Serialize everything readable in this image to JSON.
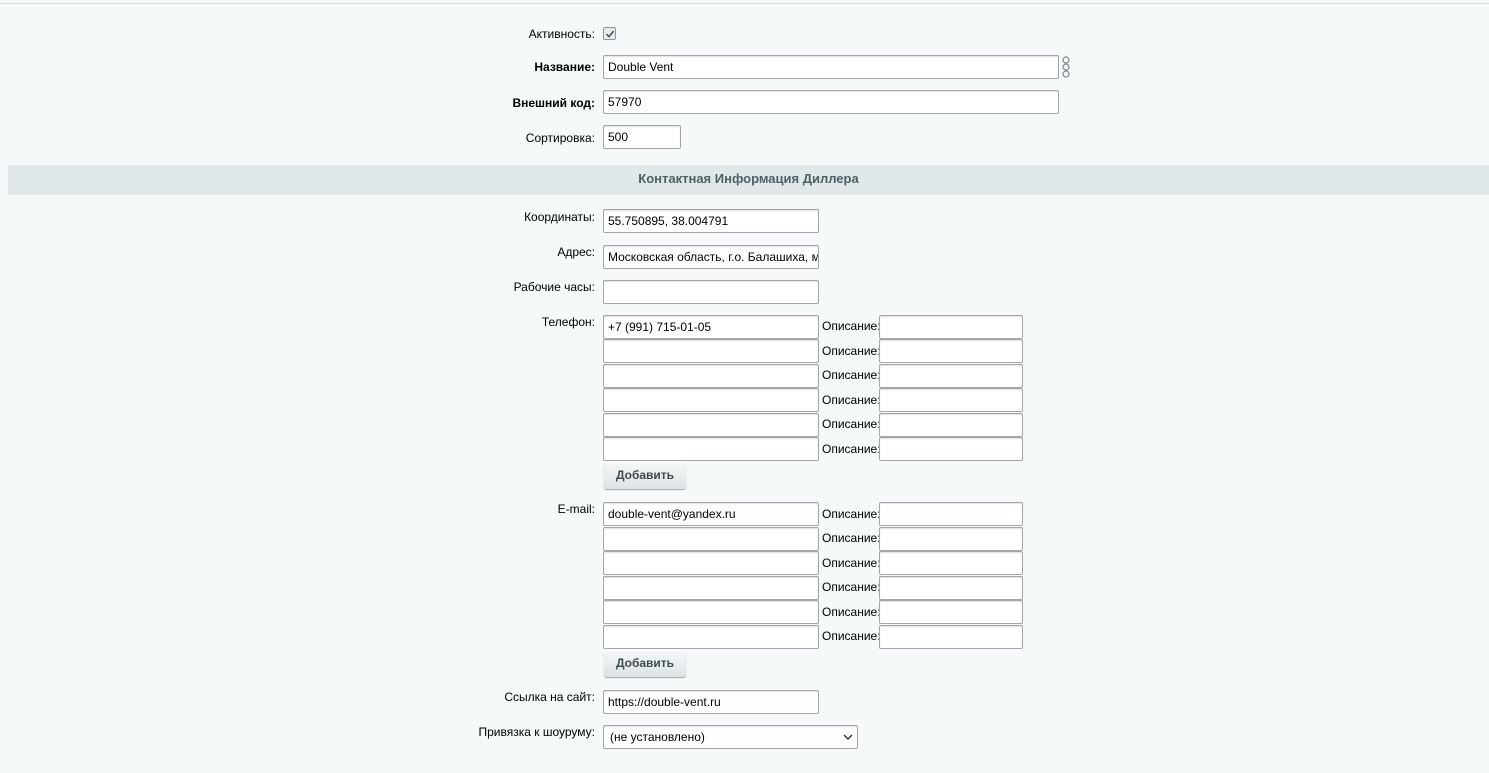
{
  "activity": {
    "label": "Активность:",
    "checked": true
  },
  "name": {
    "label": "Название:",
    "value": "Double Vent"
  },
  "external_code": {
    "label": "Внешний код:",
    "value": "57970"
  },
  "sort": {
    "label": "Сортировка:",
    "value": "500"
  },
  "section": {
    "title": "Контактная Информация Диллера"
  },
  "coords": {
    "label": "Координаты:",
    "value": "55.750895, 38.004791"
  },
  "address": {
    "label": "Адрес:",
    "value": "Московская область, г.о. Балашиха, м"
  },
  "hours": {
    "label": "Рабочие часы:",
    "value": ""
  },
  "phone": {
    "label": "Телефон:",
    "desc_label": "Описание:",
    "add_label": "Добавить",
    "rows": [
      {
        "value": "+7 (991) 715-01-05",
        "desc": ""
      },
      {
        "value": "",
        "desc": ""
      },
      {
        "value": "",
        "desc": ""
      },
      {
        "value": "",
        "desc": ""
      },
      {
        "value": "",
        "desc": ""
      },
      {
        "value": "",
        "desc": ""
      }
    ]
  },
  "email": {
    "label": "E-mail:",
    "desc_label": "Описание:",
    "add_label": "Добавить",
    "rows": [
      {
        "value": "double-vent@yandex.ru",
        "desc": ""
      },
      {
        "value": "",
        "desc": ""
      },
      {
        "value": "",
        "desc": ""
      },
      {
        "value": "",
        "desc": ""
      },
      {
        "value": "",
        "desc": ""
      },
      {
        "value": "",
        "desc": ""
      }
    ]
  },
  "site": {
    "label": "Ссылка на сайт:",
    "value": "https://double-vent.ru"
  },
  "showroom": {
    "label": "Привязка к шоуруму:",
    "value": "(не установлено)"
  },
  "icons": {
    "translit": "translit-icon",
    "check": "check-icon",
    "dropdown": "chevron-down-icon"
  }
}
